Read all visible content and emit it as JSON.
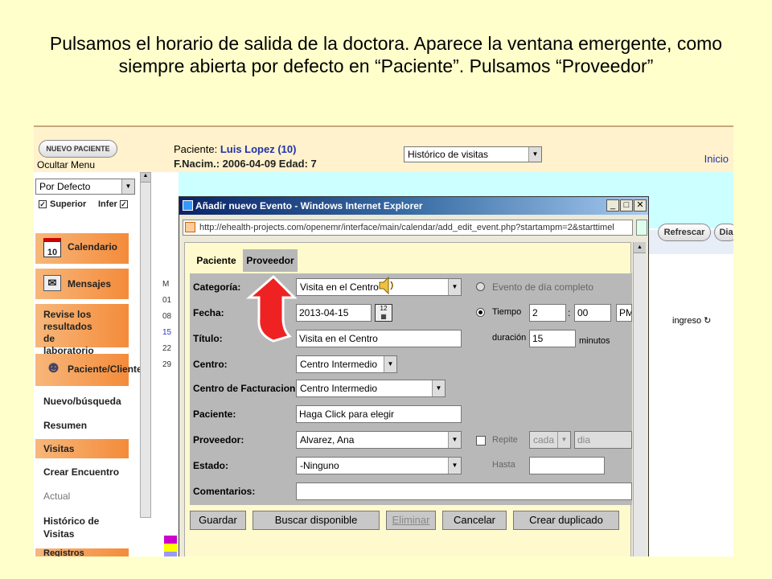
{
  "caption": "Pulsamos el horario de salida de la doctora. Aparece la ventana emergente, como siempre abierta por defecto en “Paciente”. Pulsamos “Proveedor”",
  "app": {
    "new_patient_button": "NUEVO PACIENTE",
    "hide_menu": "Ocultar Menu",
    "patient_label": "Paciente: ",
    "patient_name": "Luis Lopez (10)",
    "birth_line": "F.Nacim.: 2006-04-09 Edad: 7",
    "history_select": "Histórico de visitas",
    "inicio_link": "Inicio",
    "refresh_button": "Refrescar",
    "day_button": "Dia",
    "ingreso_text": "ingreso"
  },
  "sidebar": {
    "view_select": "Por Defecto",
    "check_superior": "Superior",
    "check_infer": "Infer",
    "items": {
      "calendario": "Calendario",
      "mensajes": "Mensajes",
      "revise": "Revise los resultados de laboratorio",
      "paciente_cliente": "Paciente/Cliente",
      "nuevo_busqueda": "Nuevo/búsqueda",
      "resumen": "Resumen",
      "visitas": "Visitas",
      "crear_encuentro": "Crear Encuentro",
      "actual": "Actual",
      "historico": "Histórico de Visitas",
      "registros": "Registros"
    },
    "calendar_day": "10",
    "mid_letters": [
      "M",
      "01",
      "08",
      "15",
      "22",
      "29"
    ]
  },
  "popup": {
    "title": "Añadir nuevo Evento - Windows Internet Explorer",
    "url": "http://ehealth-projects.com/openemr/interface/main/calendar/add_edit_event.php?startampm=2&starttimel",
    "tabs": {
      "paciente": "Paciente",
      "proveedor": "Proveedor"
    },
    "form": {
      "categoria_label": "Categoría:",
      "categoria_value": "Visita en el Centro",
      "fecha_label": "Fecha:",
      "fecha_value": "2013-04-15",
      "titulo_label": "Título:",
      "titulo_value": "Visita en el Centro",
      "centro_label": "Centro:",
      "centro_value": "Centro Intermedio",
      "facturacion_label": "Centro de Facturacion:",
      "facturacion_value": "Centro Intermedio",
      "paciente_label": "Paciente:",
      "paciente_value": "Haga Click para elegir",
      "proveedor_label": "Proveedor:",
      "proveedor_value": "Alvarez, Ana",
      "estado_label": "Estado:",
      "estado_value": "-Ninguno",
      "comentarios_label": "Comentarios:",
      "evento_dia": "Evento de día completo",
      "tiempo_label": "Tiempo",
      "hour": "2",
      "minute": "00",
      "ampm": "PM",
      "duracion_label": "duración",
      "duracion_value": "15",
      "minutos": "minutos",
      "repite_label": "Repite",
      "repite_cada": "cada",
      "repite_dia": "dia",
      "hasta_label": "Hasta"
    },
    "buttons": {
      "guardar": "Guardar",
      "buscar": "Buscar disponible",
      "eliminar": "Eliminar",
      "cancelar": "Cancelar",
      "duplicado": "Crear duplicado"
    }
  },
  "colors": {
    "slide_bg": "#ffffcc",
    "menu_orange": "#f48b3a",
    "arrow_red": "#e02020",
    "title_bar": "#0a246a"
  }
}
